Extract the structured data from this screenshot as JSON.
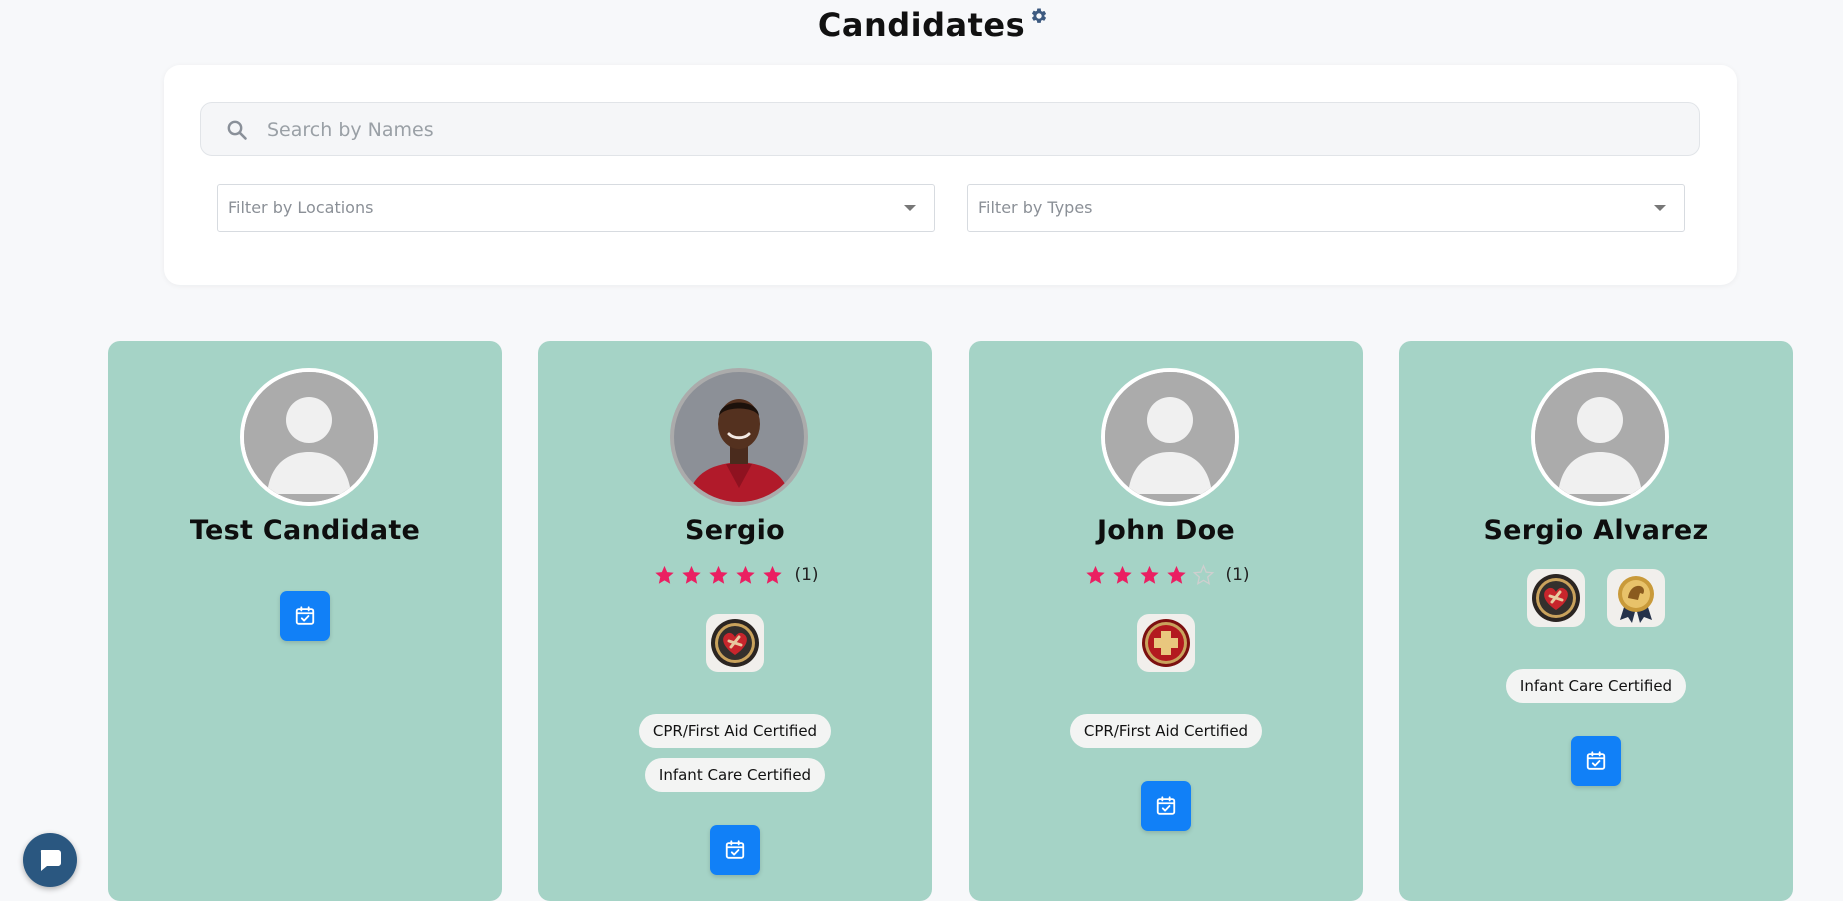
{
  "page": {
    "title": "Candidates"
  },
  "search": {
    "placeholder": "Search by Names",
    "value": ""
  },
  "filters": {
    "locations_placeholder": "Filter by Locations",
    "types_placeholder": "Filter by Types"
  },
  "colors": {
    "card_bg": "#a5d3c6",
    "accent": "#1180f7",
    "star": "#ea1f62",
    "star_empty": "#cfcfcf"
  },
  "candidates": [
    {
      "name": "Test Candidate",
      "avatar": "default-avatar",
      "rating": null,
      "badges": [],
      "certifications": []
    },
    {
      "name": "Sergio",
      "avatar": "photo",
      "rating": {
        "stars": 5,
        "count": "(1)"
      },
      "badges": [
        "cpr-heart-badge"
      ],
      "certifications": [
        "CPR/First Aid Certified",
        "Infant Care Certified"
      ]
    },
    {
      "name": "John Doe",
      "avatar": "default-avatar",
      "rating": {
        "stars": 4,
        "count": "(1)"
      },
      "badges": [
        "medical-cross-badge"
      ],
      "certifications": [
        "CPR/First Aid Certified"
      ]
    },
    {
      "name": "Sergio Alvarez",
      "avatar": "default-avatar",
      "rating": null,
      "badges": [
        "cpr-heart-badge",
        "gold-award-badge"
      ],
      "certifications": [
        "Infant Care Certified"
      ]
    }
  ],
  "icons": {
    "settings": "gear-icon",
    "search": "search-icon",
    "schedule": "calendar-check-icon",
    "chat": "chat-bubble-icon"
  }
}
